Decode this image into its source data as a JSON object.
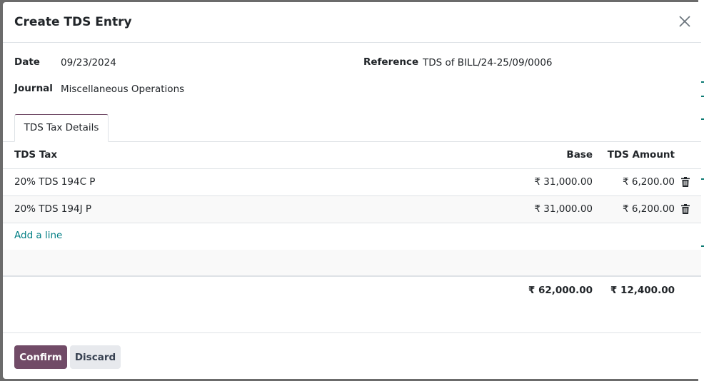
{
  "dialog": {
    "title": "Create TDS Entry"
  },
  "fields": {
    "date_label": "Date",
    "date_value": "09/23/2024",
    "reference_label": "Reference",
    "reference_value": "TDS of BILL/24-25/09/0006",
    "journal_label": "Journal",
    "journal_value": "Miscellaneous Operations"
  },
  "tabs": [
    {
      "label": "TDS Tax Details",
      "active": true
    }
  ],
  "table": {
    "headers": {
      "tax": "TDS Tax",
      "base": "Base",
      "amount": "TDS Amount"
    },
    "rows": [
      {
        "tax": "20% TDS 194C P",
        "base": "₹ 31,000.00",
        "amount": "₹ 6,200.00"
      },
      {
        "tax": "20% TDS 194J P",
        "base": "₹ 31,000.00",
        "amount": "₹ 6,200.00"
      }
    ],
    "add_line_label": "Add a line",
    "totals": {
      "base": "₹ 62,000.00",
      "amount": "₹ 12,400.00"
    }
  },
  "footer": {
    "confirm_label": "Confirm",
    "discard_label": "Discard"
  },
  "colors": {
    "primary": "#714b67",
    "link": "#017e84",
    "secondary_button": "#e7e9ed"
  },
  "icons": {
    "close": "close-icon",
    "delete": "trash-icon"
  }
}
